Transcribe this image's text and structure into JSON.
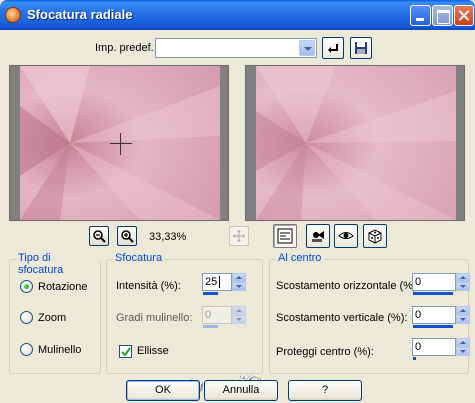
{
  "window": {
    "title": "Sfocatura radiale"
  },
  "preset": {
    "label": "Imp. predef.:",
    "value": ""
  },
  "zoom": {
    "value": "33,33%"
  },
  "blur_type": {
    "title": "Tipo di sfocatura",
    "options": [
      "Rotazione",
      "Zoom",
      "Mulinello"
    ],
    "selected": "Rotazione"
  },
  "blur": {
    "title": "Sfocatura",
    "intensity_label": "Intensità (%):",
    "intensity_value": "25",
    "twist_label": "Gradi mulinello:",
    "twist_value": "0",
    "ellipse_label": "Ellisse",
    "ellipse_checked": true
  },
  "center": {
    "title": "Al centro",
    "h_offset_label": "Scostamento orizzontale (%):",
    "h_offset_value": "0",
    "v_offset_label": "Scostamento verticale (%):",
    "v_offset_value": "0",
    "protect_label": "Proteggi centro (%):",
    "protect_value": "0"
  },
  "watermark": "Pinucci@",
  "buttons": {
    "ok": "OK",
    "cancel": "Annulla",
    "help": "?"
  },
  "icons": [
    "app-icon",
    "minimize-icon",
    "maximize-icon",
    "close-icon",
    "preset-reset-icon",
    "preset-save-icon",
    "zoom-out-icon",
    "zoom-in-icon",
    "pan-icon",
    "proof-icon",
    "randomize-icon",
    "eye-icon",
    "dice-icon"
  ],
  "colors": {
    "titlebar": "#2a72e8",
    "dialog_bg": "#ece9d8",
    "group_title": "#0046d5",
    "preview_pink": "#d9a6b6"
  }
}
